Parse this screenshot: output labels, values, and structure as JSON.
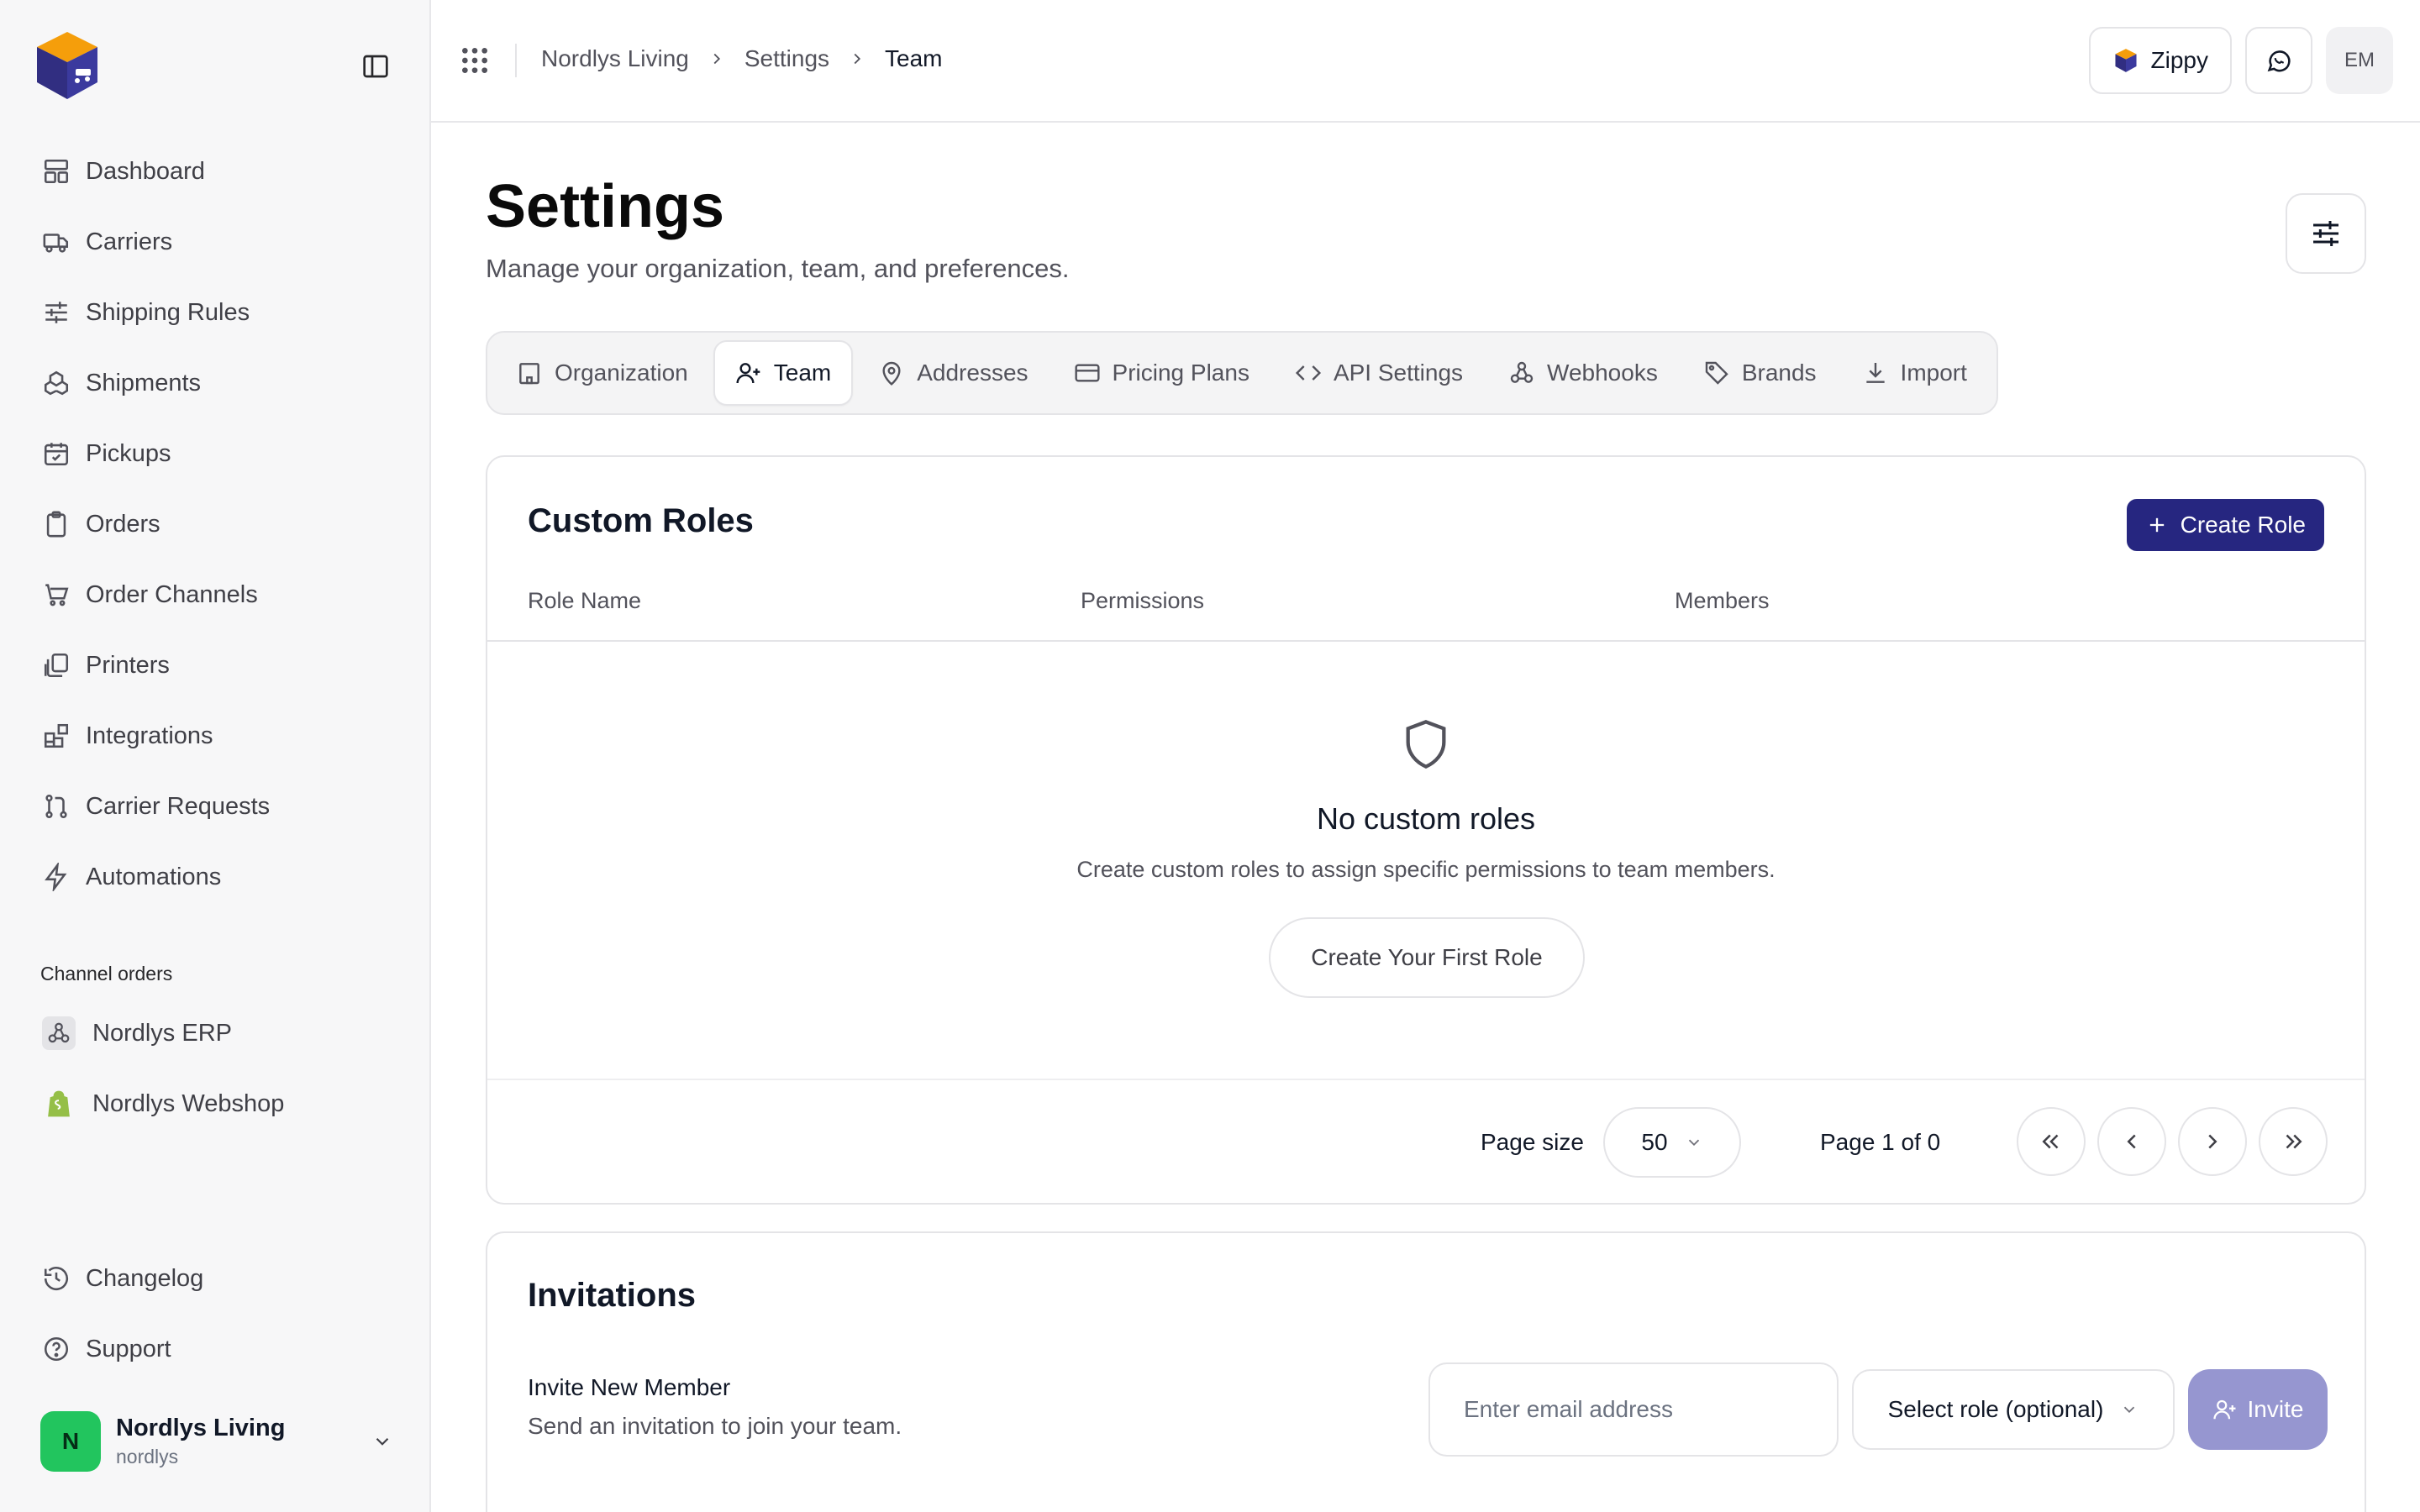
{
  "sidebar": {
    "items": [
      {
        "label": "Dashboard",
        "icon": "dashboard-icon"
      },
      {
        "label": "Carriers",
        "icon": "truck-icon"
      },
      {
        "label": "Shipping Rules",
        "icon": "sliders-icon"
      },
      {
        "label": "Shipments",
        "icon": "boxes-icon"
      },
      {
        "label": "Pickups",
        "icon": "calendar-check-icon"
      },
      {
        "label": "Orders",
        "icon": "clipboard-icon"
      },
      {
        "label": "Order Channels",
        "icon": "cart-icon"
      },
      {
        "label": "Printers",
        "icon": "copies-icon"
      },
      {
        "label": "Integrations",
        "icon": "blocks-icon"
      },
      {
        "label": "Carrier Requests",
        "icon": "pull-request-icon"
      },
      {
        "label": "Automations",
        "icon": "zap-icon"
      }
    ],
    "section_label": "Channel orders",
    "channels": [
      {
        "label": "Nordlys ERP",
        "icon": "webhook-icon"
      },
      {
        "label": "Nordlys Webshop",
        "icon": "shopify-icon"
      }
    ],
    "bottom": [
      {
        "label": "Changelog",
        "icon": "history-icon"
      },
      {
        "label": "Support",
        "icon": "help-circle-icon"
      }
    ],
    "user": {
      "initial": "N",
      "name": "Nordlys Living",
      "handle": "nordlys"
    }
  },
  "header": {
    "breadcrumb": [
      "Nordlys Living",
      "Settings",
      "Team"
    ],
    "zippy_label": "Zippy",
    "initials": "EM"
  },
  "page": {
    "title": "Settings",
    "subtitle": "Manage your organization, team, and preferences."
  },
  "tabs": [
    {
      "label": "Organization",
      "icon": "building-icon",
      "active": false
    },
    {
      "label": "Team",
      "icon": "user-plus-icon",
      "active": true
    },
    {
      "label": "Addresses",
      "icon": "map-pin-icon",
      "active": false
    },
    {
      "label": "Pricing Plans",
      "icon": "credit-card-icon",
      "active": false
    },
    {
      "label": "API Settings",
      "icon": "code-icon",
      "active": false
    },
    {
      "label": "Webhooks",
      "icon": "webhook-icon",
      "active": false
    },
    {
      "label": "Brands",
      "icon": "tag-icon",
      "active": false
    },
    {
      "label": "Import",
      "icon": "download-icon",
      "active": false
    }
  ],
  "roles": {
    "title": "Custom Roles",
    "create_label": "Create Role",
    "columns": [
      "Role Name",
      "Permissions",
      "Members"
    ],
    "empty_title": "No custom roles",
    "empty_desc": "Create custom roles to assign specific permissions to team members.",
    "first_role_label": "Create Your First Role",
    "page_size_label": "Page size",
    "page_size_value": "50",
    "page_info": "Page 1 of 0"
  },
  "invitations": {
    "title": "Invitations",
    "invite_label": "Invite New Member",
    "invite_desc": "Send an invitation to join your team.",
    "email_placeholder": "Enter email address",
    "role_placeholder": "Select role (optional)",
    "invite_button": "Invite"
  },
  "colors": {
    "primary": "#262680",
    "invite_disabled": "#9696d0",
    "logo_orange": "#f59e0b",
    "logo_indigo": "#312e81",
    "avatar_green": "#22c55e"
  }
}
